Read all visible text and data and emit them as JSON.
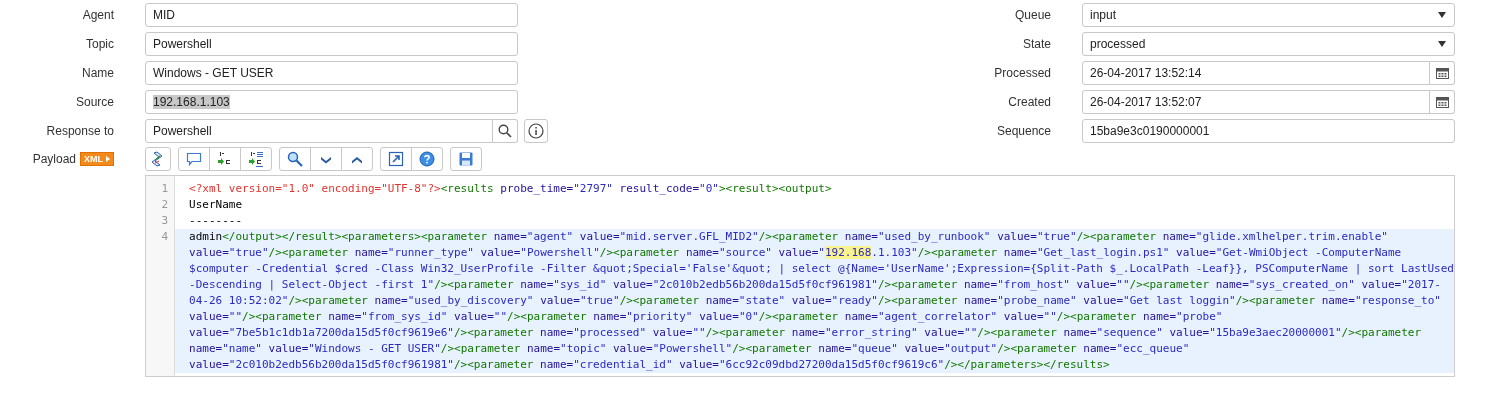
{
  "form": {
    "left_fields": [
      {
        "label": "Agent",
        "kind": "text",
        "value": "MID",
        "text_selected": false
      },
      {
        "label": "Topic",
        "kind": "text",
        "value": "Powershell",
        "text_selected": false
      },
      {
        "label": "Name",
        "kind": "text",
        "value": "Windows - GET USER",
        "text_selected": false
      },
      {
        "label": "Source",
        "kind": "text",
        "value": "192.168.1.103",
        "text_selected": true
      },
      {
        "label": "Response to",
        "kind": "reference",
        "value": "Powershell",
        "text_selected": false
      }
    ],
    "right_fields": [
      {
        "label": "Queue",
        "kind": "select",
        "value": "input"
      },
      {
        "label": "State",
        "kind": "select",
        "value": "processed"
      },
      {
        "label": "Processed",
        "kind": "date",
        "value": "26-04-2017 13:52:14"
      },
      {
        "label": "Created",
        "kind": "date",
        "value": "26-04-2017 13:52:07"
      },
      {
        "label": "Sequence",
        "kind": "text",
        "value": "15ba9e3c0190000001"
      }
    ]
  },
  "payload": {
    "label": "Payload",
    "badge": "XML",
    "editor": {
      "lines": [
        {
          "number": "1",
          "active": false,
          "rows": [
            "<?xml version=\"1.0\" encoding=\"UTF-8\"?><results probe_time=\"2797\" result_code=\"0\"><result><output>"
          ]
        },
        {
          "number": "2",
          "active": false,
          "rows": [
            "UserName"
          ]
        },
        {
          "number": "3",
          "active": false,
          "rows": [
            "--------"
          ]
        },
        {
          "number": "4",
          "active": true,
          "rows": [
            "admin</output></result><parameters><parameter name=\"agent\" value=\"mid.server.GFL_MID2\"/><parameter name=\"used_by_runbook\" value=\"true\"/><parameter name=\"glide.xmlhelper.trim.enable\"",
            [
              {
                "text": "value=\"true\"/><parameter name=\"runner_type\" value=\"Powershell\"/><parameter name=\"source\" value=\"",
                "highlighted": false
              },
              {
                "text": "192.168",
                "highlighted": true
              },
              {
                "text": ".1.103\"/><parameter name=\"Get_last_login.ps1\" value=\"Get-WmiObject -ComputerName",
                "highlighted": false
              }
            ],
            "$computer -Credential $cred -Class Win32_UserProfile -Filter &quot;Special='False'&quot; | select @{Name='UserName';Expression={Split-Path $_.LocalPath -Leaf}}, PSComputerName | sort LastUsed",
            "-Descending | Select-Object -first 1\"/><parameter name=\"sys_id\" value=\"2c010b2edb56b200da15d5f0cf961981\"/><parameter name=\"from_host\" value=\"\"/><parameter name=\"sys_created_on\" value=\"2017-",
            "04-26 10:52:02\"/><parameter name=\"used_by_discovery\" value=\"true\"/><parameter name=\"state\" value=\"ready\"/><parameter name=\"probe_name\" value=\"Get last loggin\"/><parameter name=\"response_to\"",
            "value=\"\"/><parameter name=\"from_sys_id\" value=\"\"/><parameter name=\"priority\" value=\"0\"/><parameter name=\"agent_correlator\" value=\"\"/><parameter name=\"probe\"",
            "value=\"7be5b1c1db1a7200da15d5f0cf9619e6\"/><parameter name=\"processed\" value=\"\"/><parameter name=\"error_string\" value=\"\"/><parameter name=\"sequence\" value=\"15ba9e3aec20000001\"/><parameter",
            "name=\"name\" value=\"Windows - GET USER\"/><parameter name=\"topic\" value=\"Powershell\"/><parameter name=\"queue\" value=\"output\"/><parameter name=\"ecc_queue\"",
            "value=\"2c010b2edb56b200da15d5f0cf961981\"/><parameter name=\"credential_id\" value=\"6cc92c09dbd27200da15d5f0cf9619c6\"/></parameters></results>"
          ]
        }
      ]
    }
  }
}
